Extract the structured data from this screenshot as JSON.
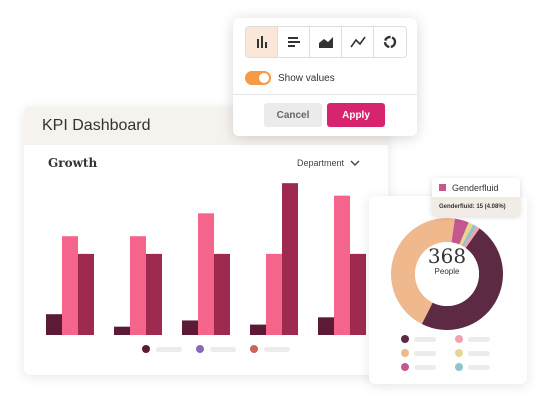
{
  "kpi": {
    "title": "KPI Dashboard",
    "section_title": "Growth",
    "dropdown_value": "Department"
  },
  "toolbar": {
    "chart_types": [
      {
        "icon": "bar-chart-icon",
        "active": true
      },
      {
        "icon": "horizontal-bar-icon",
        "active": false
      },
      {
        "icon": "area-chart-icon",
        "active": false
      },
      {
        "icon": "line-chart-icon",
        "active": false
      },
      {
        "icon": "donut-chart-icon",
        "active": false
      }
    ],
    "show_values_label": "Show values",
    "show_values_on": true,
    "cancel_label": "Cancel",
    "apply_label": "Apply"
  },
  "chart_data": [
    {
      "type": "bar",
      "categories": [
        "",
        "",
        "",
        "",
        ""
      ],
      "series": [
        {
          "color": "#5c1a36",
          "values": [
            2,
            0.8,
            1.4,
            1,
            1.7
          ]
        },
        {
          "color": "#f4648b",
          "values": [
            9.5,
            9.5,
            11.7,
            7.8,
            13.4
          ]
        },
        {
          "color": "#9e2a4f",
          "values": [
            7.8,
            7.8,
            7.8,
            14.6,
            7.8
          ]
        }
      ],
      "ylim": [
        0,
        15
      ],
      "legend_colors": [
        "#5c1a36",
        "#8b67b8",
        "#c96460"
      ]
    },
    {
      "type": "pie",
      "total": "368",
      "unit": "People",
      "slices": [
        {
          "color": "#5c2a43",
          "value": 175
        },
        {
          "color": "#efb88d",
          "value": 165
        },
        {
          "color": "#c4578e",
          "value": 15
        },
        {
          "color": "#e8d690",
          "value": 5
        },
        {
          "color": "#8dc5c9",
          "value": 4
        },
        {
          "color": "#f3a0b0",
          "value": 4
        }
      ]
    }
  ],
  "donut_legend_colors": [
    "#5c2a43",
    "#f3a0b0",
    "#efb88d",
    "#e8d690",
    "#c4578e",
    "#8dc5c9"
  ],
  "tooltip": {
    "title": "Genderfluid",
    "detail": "Genderfluid: 15 (4.08%)",
    "color": "#c4578e"
  }
}
